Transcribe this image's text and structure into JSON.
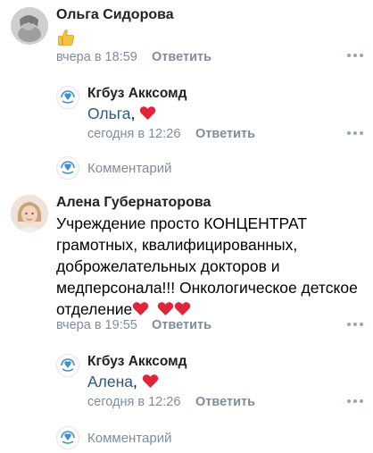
{
  "comment1": {
    "author": "Ольга Сидорова",
    "body_emoji": "thumbs-up-icon",
    "time": "вчера в 18:59",
    "reply_label": "Ответить"
  },
  "reply1": {
    "author": "Кгбуз Акксомд",
    "mention": "Ольга",
    "separator": ",",
    "time": "сегодня в 12:26",
    "reply_label": "Ответить"
  },
  "comment_input1": {
    "label": "Комментарий"
  },
  "comment2": {
    "author": "Алена Губернаторова",
    "body_lines": [
      "Учреждение просто КОНЦЕНТРАТ",
      "грамотных, квалифицированных,",
      "доброжелательных докторов и",
      "медперсонала!!! Онкологическое детское",
      "отделение"
    ],
    "time": "вчера в 19:55",
    "reply_label": "Ответить"
  },
  "reply2": {
    "author": "Кгбуз Акксомд",
    "mention": "Алена",
    "separator": ",",
    "time": "сегодня в 12:26",
    "reply_label": "Ответить"
  },
  "comment_input2": {
    "label": "Комментарий"
  },
  "colors": {
    "link": "#2a5885",
    "secondary": "#818c99",
    "heart": "#e0243a",
    "logo": "#3a8fd6"
  }
}
